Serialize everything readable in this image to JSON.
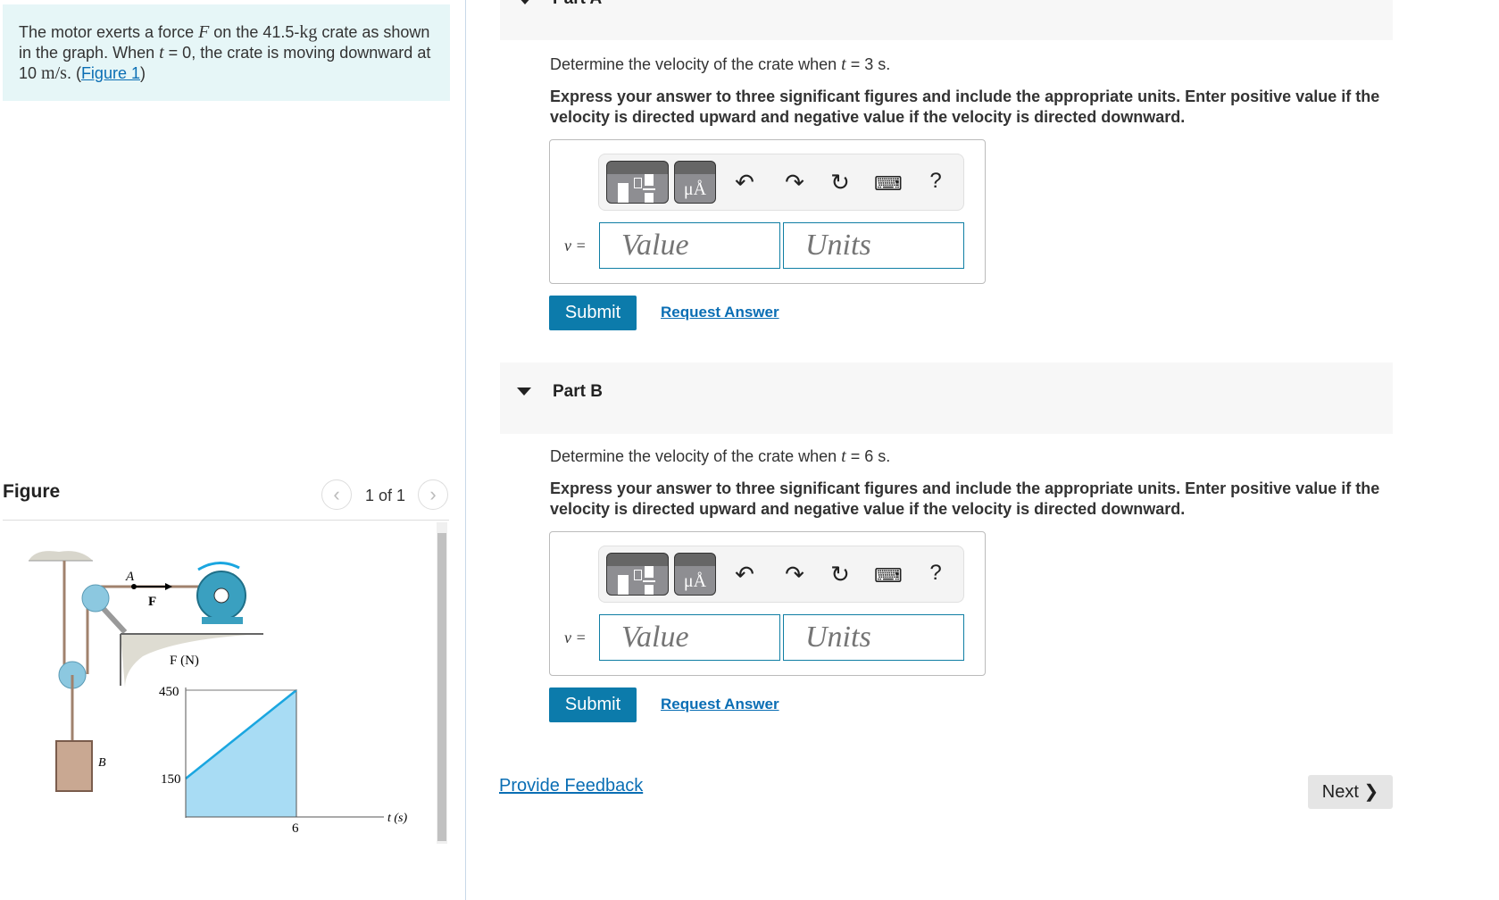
{
  "problem": {
    "t1": "The motor exerts a force ",
    "F": "F",
    "t2": " on the 41.5-",
    "kg": "kg",
    "t3": " crate as shown in the graph. When ",
    "t": "t",
    "t4": " = 0, the crate is moving downward at 10 ",
    "ms": "m/s",
    "t5": ". (",
    "link": "Figure 1",
    "t6": ")"
  },
  "figure": {
    "title": "Figure",
    "pager": "1 of 1",
    "prev": "‹",
    "next": "›",
    "labels": {
      "A": "A",
      "F": "F",
      "B": "B",
      "y_axis": "F (N)",
      "x_axis": "t (s)",
      "y_450": "450",
      "y_150": "150",
      "x_6": "6"
    },
    "colors": {
      "fill": "#a8dcf4",
      "line": "#1aa6e0"
    }
  },
  "chart_data": {
    "type": "area",
    "ylabel": "F (N)",
    "xlabel": "t (s)",
    "x": [
      0,
      6
    ],
    "y": [
      150,
      450
    ],
    "yticks": [
      150,
      450
    ],
    "xticks": [
      6
    ]
  },
  "partA": {
    "label": "Part A",
    "question_pre": "Determine the velocity of the crate when ",
    "var": "t",
    "question_post": " = 3 s.",
    "instructions": "Express your answer to three significant figures and include the appropriate units. Enter positive value if the velocity is directed upward and negative value if the velocity is directed downward.",
    "var_label": "v =",
    "value_placeholder": "Value",
    "units_placeholder": "Units",
    "submit": "Submit",
    "request": "Request Answer"
  },
  "partB": {
    "label": "Part B",
    "question_pre": "Determine the velocity of the crate when ",
    "var": "t",
    "question_post": " = 6 s.",
    "instructions": "Express your answer to three significant figures and include the appropriate units. Enter positive value if the velocity is directed upward and negative value if the velocity is directed downward.",
    "var_label": "v =",
    "value_placeholder": "Value",
    "units_placeholder": "Units",
    "submit": "Submit",
    "request": "Request Answer"
  },
  "toolbar": {
    "units_glyph": "μÅ",
    "help": "?"
  },
  "footer": {
    "feedback": "Provide Feedback",
    "next": "Next"
  }
}
